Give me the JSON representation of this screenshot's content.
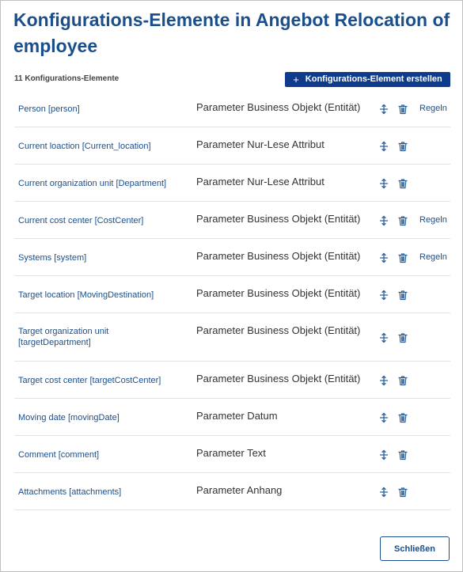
{
  "dialog": {
    "title": "Konfigurations-Elemente in Angebot Relocation of employee",
    "count_label": "11 Konfigurations-Elemente",
    "create_button_label": "Konfigurations-Element erstellen",
    "close_button_label": "Schließen"
  },
  "elements": [
    {
      "name": "Person [person]",
      "type": "Parameter Business Objekt (Entität)",
      "rules": "Regeln"
    },
    {
      "name": "Current loaction [Current_location]",
      "type": "Parameter Nur-Lese Attribut",
      "rules": ""
    },
    {
      "name": "Current organization unit [Department]",
      "type": "Parameter Nur-Lese Attribut",
      "rules": ""
    },
    {
      "name": "Current cost center [CostCenter]",
      "type": "Parameter Business Objekt (Entität)",
      "rules": "Regeln"
    },
    {
      "name": "Systems [system]",
      "type": "Parameter Business Objekt (Entität)",
      "rules": "Regeln"
    },
    {
      "name": "Target location [MovingDestination]",
      "type": "Parameter Business Objekt (Entität)",
      "rules": ""
    },
    {
      "name": "Target organization unit [targetDepartment]",
      "type": "Parameter Business Objekt (Entität)",
      "rules": ""
    },
    {
      "name": "Target cost center [targetCostCenter]",
      "type": "Parameter Business Objekt (Entität)",
      "rules": ""
    },
    {
      "name": "Moving date [movingDate]",
      "type": "Parameter Datum",
      "rules": ""
    },
    {
      "name": "Comment [comment]",
      "type": "Parameter Text",
      "rules": ""
    },
    {
      "name": "Attachments [attachments]",
      "type": "Parameter Anhang",
      "rules": ""
    }
  ],
  "icons": {
    "create": "plus-icon",
    "move": "move-icon",
    "delete": "trash-icon"
  },
  "colors": {
    "title": "#1a4f8b",
    "link": "#1a4f8b",
    "primary_button": "#0f3b8d",
    "icon": "#2d5f97"
  }
}
